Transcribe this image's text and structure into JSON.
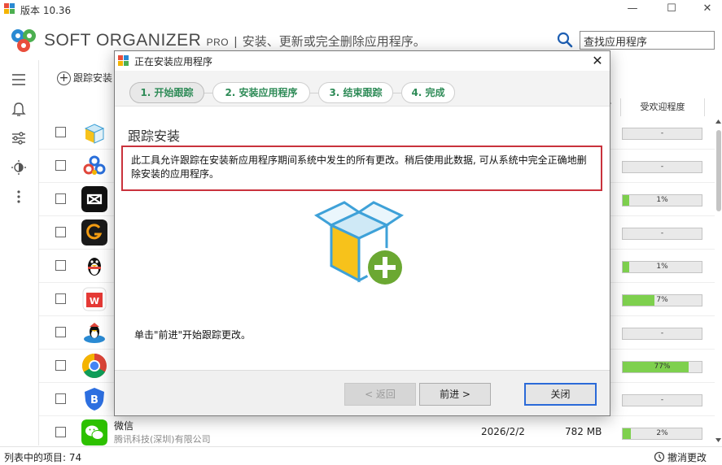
{
  "window": {
    "title": "版本 10.36",
    "controls": {
      "minimize": "—",
      "maximize": "☐",
      "close": "✕"
    }
  },
  "header": {
    "brand": "SOFT ORGANIZER",
    "brand_suffix": "PRO",
    "separator": "|",
    "tagline": "安装、更新或完全删除应用程序。",
    "search_placeholder": "查找应用程序"
  },
  "toolbar": {
    "add_label": "跟踪安装"
  },
  "columns": {
    "sort_arrow": "^",
    "popularity": "受欢迎程度"
  },
  "rows": [
    {
      "icon": "box-icon",
      "popularity": "-",
      "fill": 0
    },
    {
      "icon": "cluster-icon",
      "popularity": "-",
      "fill": 0
    },
    {
      "icon": "capcut-icon",
      "popularity": "1%",
      "fill": 0.08
    },
    {
      "icon": "app-g-icon",
      "popularity": "-",
      "fill": 0
    },
    {
      "icon": "qq-penguin-icon",
      "popularity": "1%",
      "fill": 0.08
    },
    {
      "icon": "wps-icon",
      "popularity": "7%",
      "fill": 0.4
    },
    {
      "icon": "qq-game-icon",
      "popularity": "-",
      "fill": 0
    },
    {
      "icon": "chrome-icon",
      "popularity": "77%",
      "fill": 0.84
    },
    {
      "icon": "shield-b-icon",
      "popularity": "-",
      "fill": 0
    },
    {
      "icon": "wechat-icon",
      "name": "微信",
      "publisher": "腾讯科技(深圳)有限公司",
      "date": "2026/2/2",
      "size": "782 MB",
      "popularity": "2%",
      "fill": 0.1
    }
  ],
  "status": {
    "items_label": "列表中的项目: 74",
    "undo_label": "撤消更改"
  },
  "dialog": {
    "title": "正在安装应用程序",
    "close": "✕",
    "steps": [
      "1. 开始跟踪",
      "2. 安装应用程序",
      "3. 结束跟踪",
      "4. 完成"
    ],
    "section_title": "跟踪安装",
    "description": "此工具允许跟踪在安装新应用程序期间系统中发生的所有更改。稍后使用此数据, 可从系统中完全正确地删除安装的应用程序。",
    "hint": "单击\"前进\"开始跟踪更改。",
    "buttons": {
      "back": "< 返回",
      "next": "前进 >",
      "close": "关闭"
    }
  },
  "colors": {
    "accent_green": "#2e8b57",
    "highlight_red": "#c9323c",
    "progress_green": "#7ed04e",
    "default_button_border": "#2b6ad8"
  }
}
